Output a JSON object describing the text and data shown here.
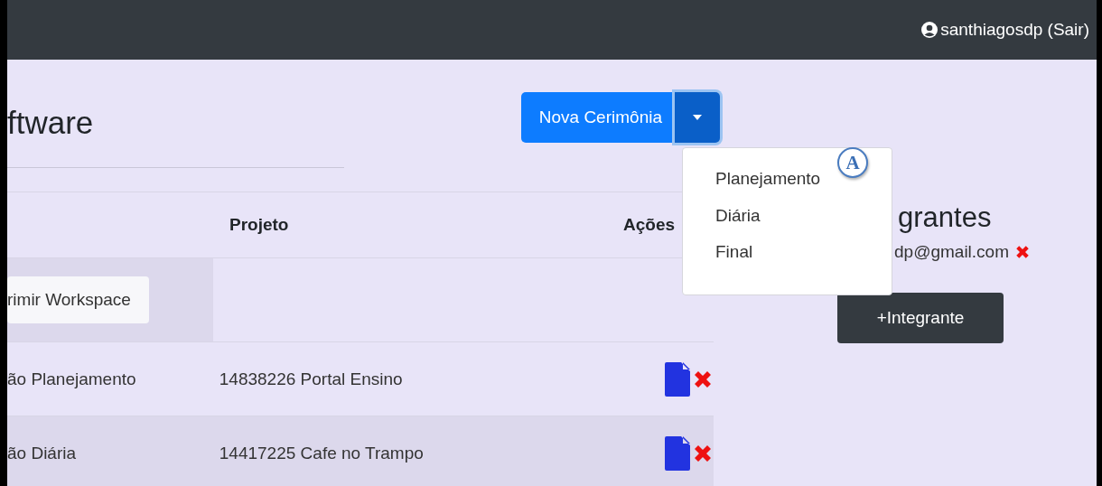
{
  "user": {
    "name": "santhiagosdp (Sair)"
  },
  "page_title": "ftware",
  "split_button": {
    "label": "Nova Cerimônia",
    "expanded": true
  },
  "dropdown_menu": [
    {
      "label": "Planejamento"
    },
    {
      "label": "Diária"
    },
    {
      "label": "Final"
    }
  ],
  "callout": {
    "label": "A"
  },
  "table": {
    "columns": [
      "Projeto",
      "Ações"
    ],
    "toolbar_button": "rimir Workspace",
    "rows": [
      {
        "column_1": "ão Planejamento",
        "project": "14838226 Portal Ensino"
      },
      {
        "column_1": "ão Diária",
        "project": "14417225 Cafe no Trampo"
      }
    ]
  },
  "members": {
    "title": "grantes",
    "items": [
      {
        "email": "dp@gmail.com"
      }
    ],
    "add_button": "+Integrante"
  }
}
